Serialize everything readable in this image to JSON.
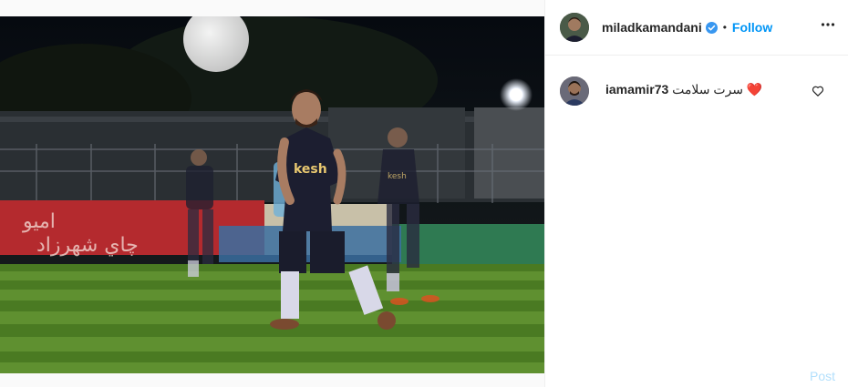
{
  "header": {
    "username": "miladkamandani",
    "separator": "•",
    "follow_label": "Follow",
    "verified_icon": "verified-badge-icon",
    "more_icon": "more-options-icon"
  },
  "comments": [
    {
      "username": "iamamir73",
      "text": "سرت سلامت ❤️",
      "like_icon": "heart-outline-icon"
    }
  ],
  "composer": {
    "post_label": "Post"
  },
  "colors": {
    "accent": "#0095f6",
    "post_disabled": "#b2dffc",
    "heart_red": "#e02020"
  },
  "photo": {
    "jersey_text": "kesh"
  }
}
